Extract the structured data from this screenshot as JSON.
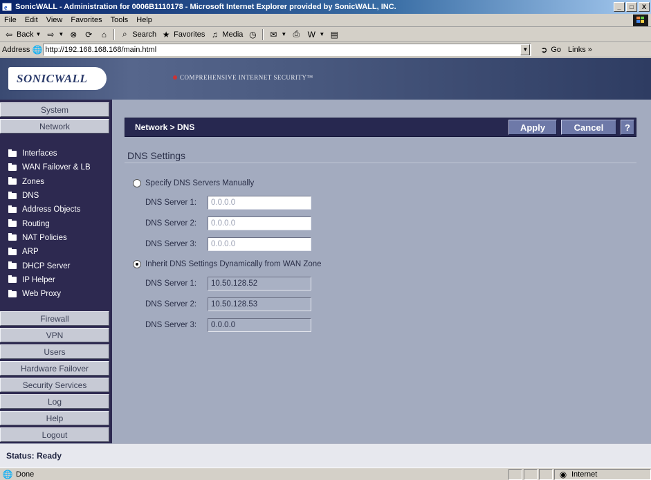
{
  "window": {
    "title": "SonicWALL - Administration for 0006B1110178 - Microsoft Internet Explorer provided by SonicWALL, INC.",
    "controls": [
      "_",
      "□",
      "X"
    ]
  },
  "menu": [
    "File",
    "Edit",
    "View",
    "Favorites",
    "Tools",
    "Help"
  ],
  "toolbar": {
    "back": "Back",
    "search": "Search",
    "favorites": "Favorites",
    "media": "Media"
  },
  "address": {
    "label": "Address",
    "url": "http://192.168.168.168/main.html",
    "go": "Go",
    "links": "Links"
  },
  "header": {
    "logo": "SONICWALL",
    "tagline": "COMPREHENSIVE INTERNET SECURITY™"
  },
  "nav": {
    "top": [
      "System",
      "Network"
    ],
    "sub": [
      "Interfaces",
      "WAN Failover & LB",
      "Zones",
      "DNS",
      "Address Objects",
      "Routing",
      "NAT Policies",
      "ARP",
      "DHCP Server",
      "IP Helper",
      "Web Proxy"
    ],
    "bottom": [
      "Firewall",
      "VPN",
      "Users",
      "Hardware Failover",
      "Security Services",
      "Log",
      "Help",
      "Logout"
    ]
  },
  "section": {
    "breadcrumb": "Network > DNS",
    "apply": "Apply",
    "cancel": "Cancel",
    "help": "?"
  },
  "dns": {
    "title": "DNS Settings",
    "manual_label": "Specify DNS Servers Manually",
    "manual": [
      {
        "label": "DNS Server 1:",
        "value": "0.0.0.0"
      },
      {
        "label": "DNS Server 2:",
        "value": "0.0.0.0"
      },
      {
        "label": "DNS Server 3:",
        "value": "0.0.0.0"
      }
    ],
    "inherit_label": "Inherit DNS Settings Dynamically from WAN Zone",
    "inherit": [
      {
        "label": "DNS Server 1:",
        "value": "10.50.128.52"
      },
      {
        "label": "DNS Server 2:",
        "value": "10.50.128.53"
      },
      {
        "label": "DNS Server 3:",
        "value": "0.0.0.0"
      }
    ]
  },
  "status": {
    "label": "Status:",
    "value": "Ready"
  },
  "ie_status": {
    "done": "Done",
    "zone": "Internet"
  }
}
